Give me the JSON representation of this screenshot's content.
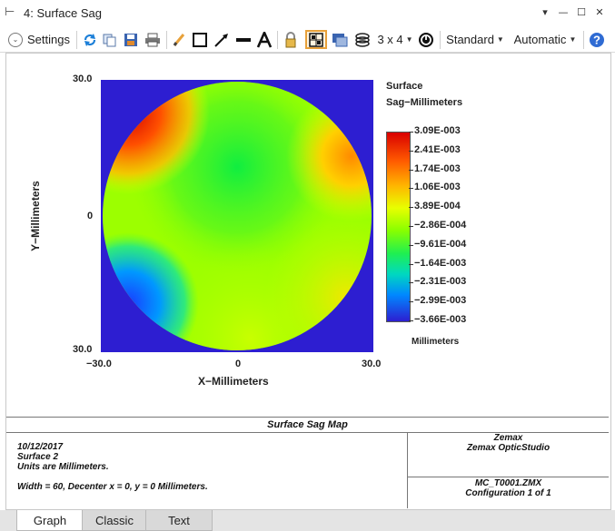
{
  "window": {
    "title": "4: Surface Sag",
    "glyph": "⊢",
    "buttons": {
      "menu": "▾",
      "minimize": "—",
      "restore": "☐",
      "close": "✕"
    }
  },
  "toolbar": {
    "settings_label": "Settings",
    "layout_label": "3 x 4",
    "standard_label": "Standard",
    "automatic_label": "Automatic",
    "icons": [
      "refresh-icon",
      "copy-icon",
      "save-icon",
      "print-icon",
      "pencil-icon",
      "rectangle-icon",
      "arrow-icon",
      "line-icon",
      "text-icon",
      "lock-icon",
      "layout-grid-icon",
      "window-icon",
      "layers-icon",
      "timer-icon",
      "help-icon"
    ],
    "colors": {
      "accent": "#e8a13a",
      "help_blue": "#2f6bd3",
      "refresh_blue": "#1c7fd8"
    }
  },
  "plot": {
    "y_top": "30.0",
    "y_mid": "0",
    "y_bottom": "30.0",
    "x_left": "−30.0",
    "x_mid": "0",
    "x_right": "30.0",
    "xlabel": "X−Millimeters",
    "ylabel": "Y−Millimeters",
    "legend_title_1": "Surface",
    "legend_title_2": "Sag−Millimeters",
    "legend_units": "Millimeters",
    "background_color": "#2d1ed1"
  },
  "chart_data": {
    "type": "heatmap",
    "title": "Surface Sag Map",
    "xlabel": "X−Millimeters",
    "ylabel": "Y−Millimeters",
    "xlim": [
      -30.0,
      30.0
    ],
    "ylim": [
      -30.0,
      30.0
    ],
    "colorbar_label": "Surface Sag−Millimeters",
    "colorbar_ticks": [
      "3.09E-003",
      "2.41E-003",
      "1.74E-003",
      "1.06E-003",
      "3.89E-004",
      "−2.86E-004",
      "−9.61E-004",
      "−1.64E-003",
      "−2.31E-003",
      "−2.99E-003",
      "−3.66E-003"
    ],
    "colorbar_colors": [
      "#d90000",
      "#ff5a00",
      "#ffb400",
      "#e8ff00",
      "#88ff00",
      "#20f050",
      "#00d8c0",
      "#0088ff",
      "#2d1ed1"
    ]
  },
  "info": {
    "title": "Surface Sag Map",
    "date": "10/12/2017",
    "surface": "Surface 2",
    "units": "Units are Millimeters.",
    "width_line": "Width = 60, Decenter x = 0, y = 0 Millimeters.",
    "company": "Zemax",
    "product": "Zemax OpticStudio",
    "file": "MC_T0001.ZMX",
    "config": "Configuration 1 of 1"
  },
  "tabs": [
    "Graph",
    "Classic",
    "Text"
  ]
}
